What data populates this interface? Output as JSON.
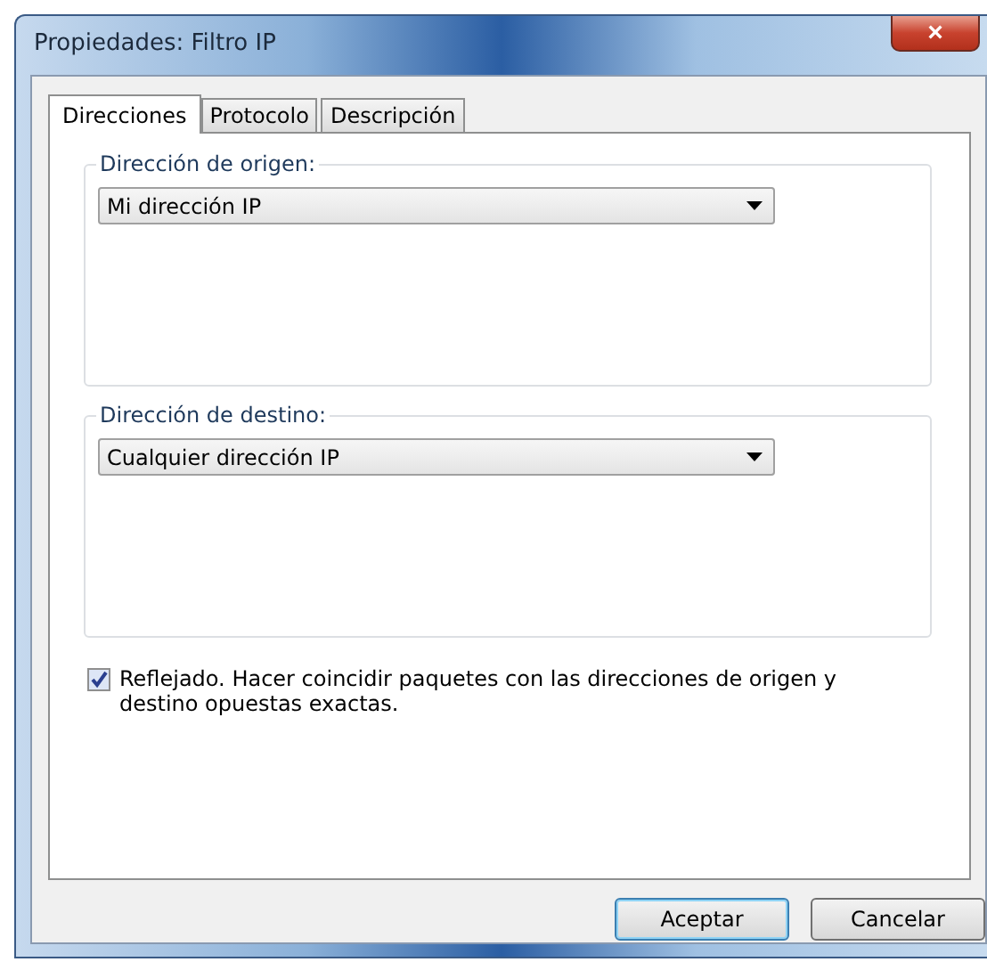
{
  "window": {
    "title": "Propiedades: Filtro IP",
    "close": "×"
  },
  "tabs": [
    {
      "label": "Direcciones",
      "selected": true
    },
    {
      "label": "Protocolo",
      "selected": false
    },
    {
      "label": "Descripción",
      "selected": false
    }
  ],
  "groups": [
    {
      "label": "Dirección de origen:",
      "value": "Mi dirección IP"
    },
    {
      "label": "Dirección de destino:",
      "value": "Cualquier dirección IP"
    }
  ],
  "mirror": {
    "label": "Reflejado. Hacer coincidir paquetes con las direcciones de origen y destino opuestas exactas.",
    "checked": true
  },
  "buttons": [
    {
      "label": "Aceptar",
      "default": true
    },
    {
      "label": "Cancelar",
      "default": false
    }
  ]
}
